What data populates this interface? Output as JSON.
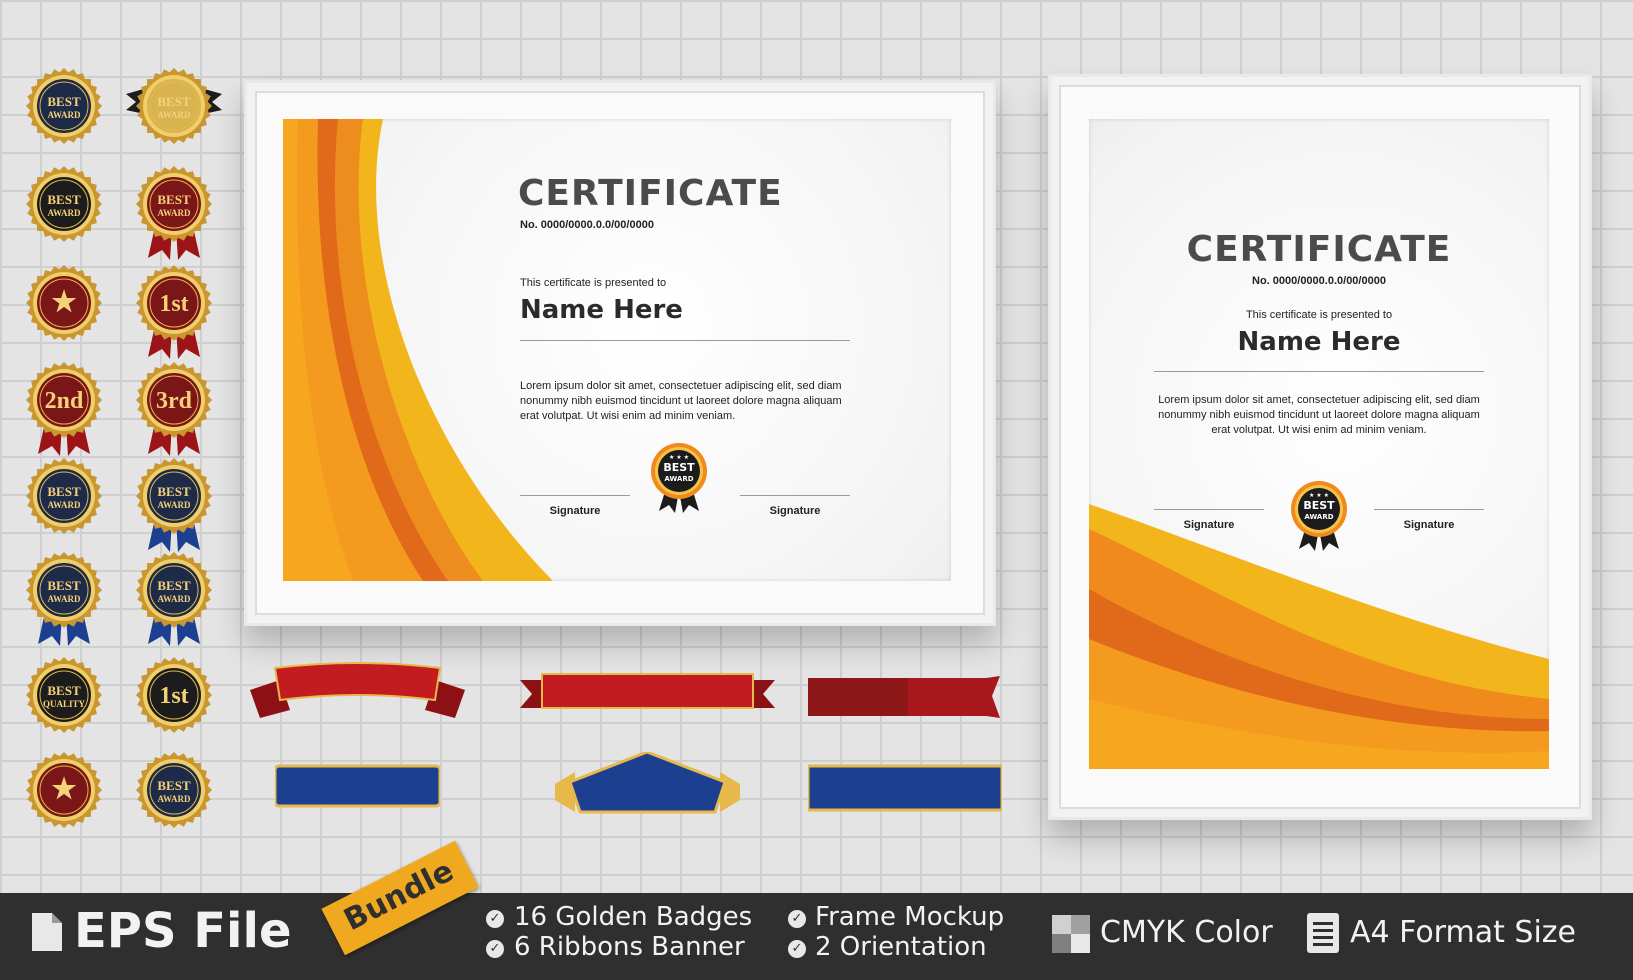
{
  "landscape": {
    "title": "CERTIFICATE",
    "number": "No. 0000/0000.0.0/00/0000",
    "presented": "This certificate is presented to",
    "name": "Name Here",
    "lorem": "Lorem ipsum dolor sit amet, consectetuer adipiscing elit, sed diam nonummy nibh euismod tincidunt ut laoreet dolore magna aliquam erat volutpat. Ut wisi enim ad minim veniam.",
    "signature_left": "Signature",
    "signature_right": "Signature",
    "seal_line1": "BEST",
    "seal_line2": "AWARD"
  },
  "portrait": {
    "title": "CERTIFICATE",
    "number": "No. 0000/0000.0.0/00/0000",
    "presented": "This certificate is presented to",
    "name": "Name Here",
    "lorem": "Lorem ipsum dolor sit amet, consectetuer adipiscing elit, sed diam nonummy nibh euismod tincidunt ut laoreet dolore magna aliquam erat volutpat. Ut wisi enim ad minim veniam.",
    "signature_left": "Signature",
    "signature_right": "Signature",
    "seal_line1": "BEST",
    "seal_line2": "AWARD"
  },
  "badges": [
    {
      "line1": "BEST",
      "line2": "AWARD",
      "color": "#1d2a48",
      "ribbon": "none"
    },
    {
      "line1": "BEST",
      "line2": "AWARD",
      "color": "#d9b34f",
      "ribbon": "black"
    },
    {
      "line1": "BEST",
      "line2": "AWARD",
      "color": "#1c1c1c",
      "ribbon": "none"
    },
    {
      "line1": "BEST",
      "line2": "AWARD",
      "color": "#7a1518",
      "ribbon": "red"
    },
    {
      "line1": "★",
      "line2": "",
      "color": "#7a1518",
      "ribbon": "none"
    },
    {
      "line1": "1st",
      "line2": "",
      "color": "#7a1518",
      "ribbon": "red"
    },
    {
      "line1": "2nd",
      "line2": "",
      "color": "#7a1518",
      "ribbon": "red"
    },
    {
      "line1": "3rd",
      "line2": "",
      "color": "#7a1518",
      "ribbon": "red"
    },
    {
      "line1": "BEST",
      "line2": "AWARD",
      "color": "#1d2a48",
      "ribbon": "none"
    },
    {
      "line1": "BEST",
      "line2": "AWARD",
      "color": "#1d2a48",
      "ribbon": "blue"
    },
    {
      "line1": "BEST",
      "line2": "AWARD",
      "color": "#1d2a48",
      "ribbon": "blue"
    },
    {
      "line1": "BEST",
      "line2": "AWARD",
      "color": "#1d2a48",
      "ribbon": "blue"
    },
    {
      "line1": "BEST",
      "line2": "QUALITY",
      "color": "#1c1c1c",
      "ribbon": "none"
    },
    {
      "line1": "1st",
      "line2": "",
      "color": "#1c1c1c",
      "ribbon": "none"
    },
    {
      "line1": "★",
      "line2": "",
      "color": "#7a1518",
      "ribbon": "none"
    },
    {
      "line1": "BEST",
      "line2": "AWARD",
      "color": "#1d2a48",
      "ribbon": "none"
    }
  ],
  "footer": {
    "eps_label": "EPS File",
    "bundle_label": "Bundle",
    "feature_1": "16 Golden Badges",
    "feature_2": "6  Ribbons Banner",
    "feature_3": "Frame Mockup",
    "feature_4": "2 Orientation",
    "cmyk_label": "CMYK Color",
    "a4_label": "A4 Format Size"
  },
  "colors": {
    "orange": "#f08a1c",
    "gold": "#f3b51c",
    "dark_orange": "#e06a1a",
    "ribbon_red": "#b3161b",
    "ribbon_blue": "#1d3f8f",
    "footer_bg": "#2f2f2f"
  }
}
